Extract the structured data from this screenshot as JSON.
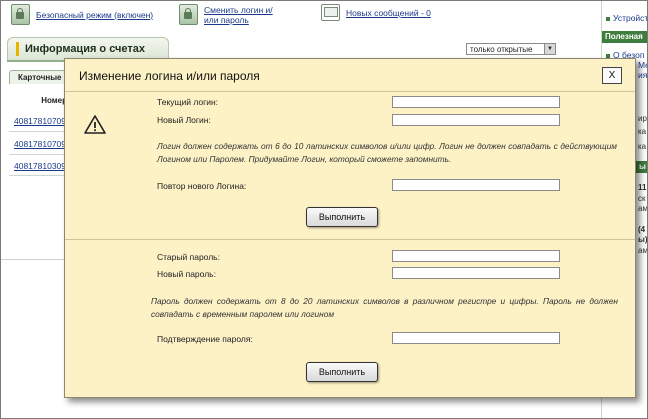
{
  "topbar": {
    "safe_mode": "Безопасный режим (включен)",
    "change_login_line1": "Сменить логин и/",
    "change_login_line2": "или пароль",
    "new_messages": "Новых сообщений - 0"
  },
  "main": {
    "section_title": "Информация о счетах",
    "filter_value": "только открытые",
    "tab_label": "Карточные",
    "column_header": "Номер",
    "accounts": [
      "40817810709",
      "40817810709",
      "40817810309"
    ]
  },
  "right_panel": {
    "link1": "Устройст",
    "head1": "Полезная",
    "link2_line1": "О безоп",
    "link2_line2": "Med",
    "link2_line3": "ия по",
    "frag1": "ира",
    "frag2": "ка",
    "frag3": "ка",
    "head2": "ы",
    "frag4": "11",
    "frag5": "ск",
    "frag6": "ам",
    "frag7": "(4",
    "frag8": "ы)",
    "frag9": "ам"
  },
  "modal": {
    "title": "Изменение логина и/или пароля",
    "close": "X",
    "current_login_label": "Текущий логин:",
    "new_login_label": "Новый Логин:",
    "login_hint": "Логин должен содержать от 6 до 10 латинских символов и/или цифр. Логин не должен совпадать с действующим Логином или Паролем. Придумайте Логин, который сможете запомнить.",
    "repeat_login_label": "Повтор нового Логина:",
    "execute_label": "Выполнить",
    "old_password_label": "Старый пароль:",
    "new_password_label": "Новый пароль:",
    "password_hint": "Пароль должен содержать от 8 до 20 латинских символов в различном регистре и цифры. Пароль не должен совпадать с временным паролем или логином",
    "confirm_password_label": "Подтверждение пароля:",
    "execute_label_2": "Выполнить"
  },
  "icons": {
    "safe_mode": "padlock-icon",
    "change_login": "padlock-icon",
    "messages": "envelope-icon",
    "warning": "warning-triangle-icon"
  }
}
